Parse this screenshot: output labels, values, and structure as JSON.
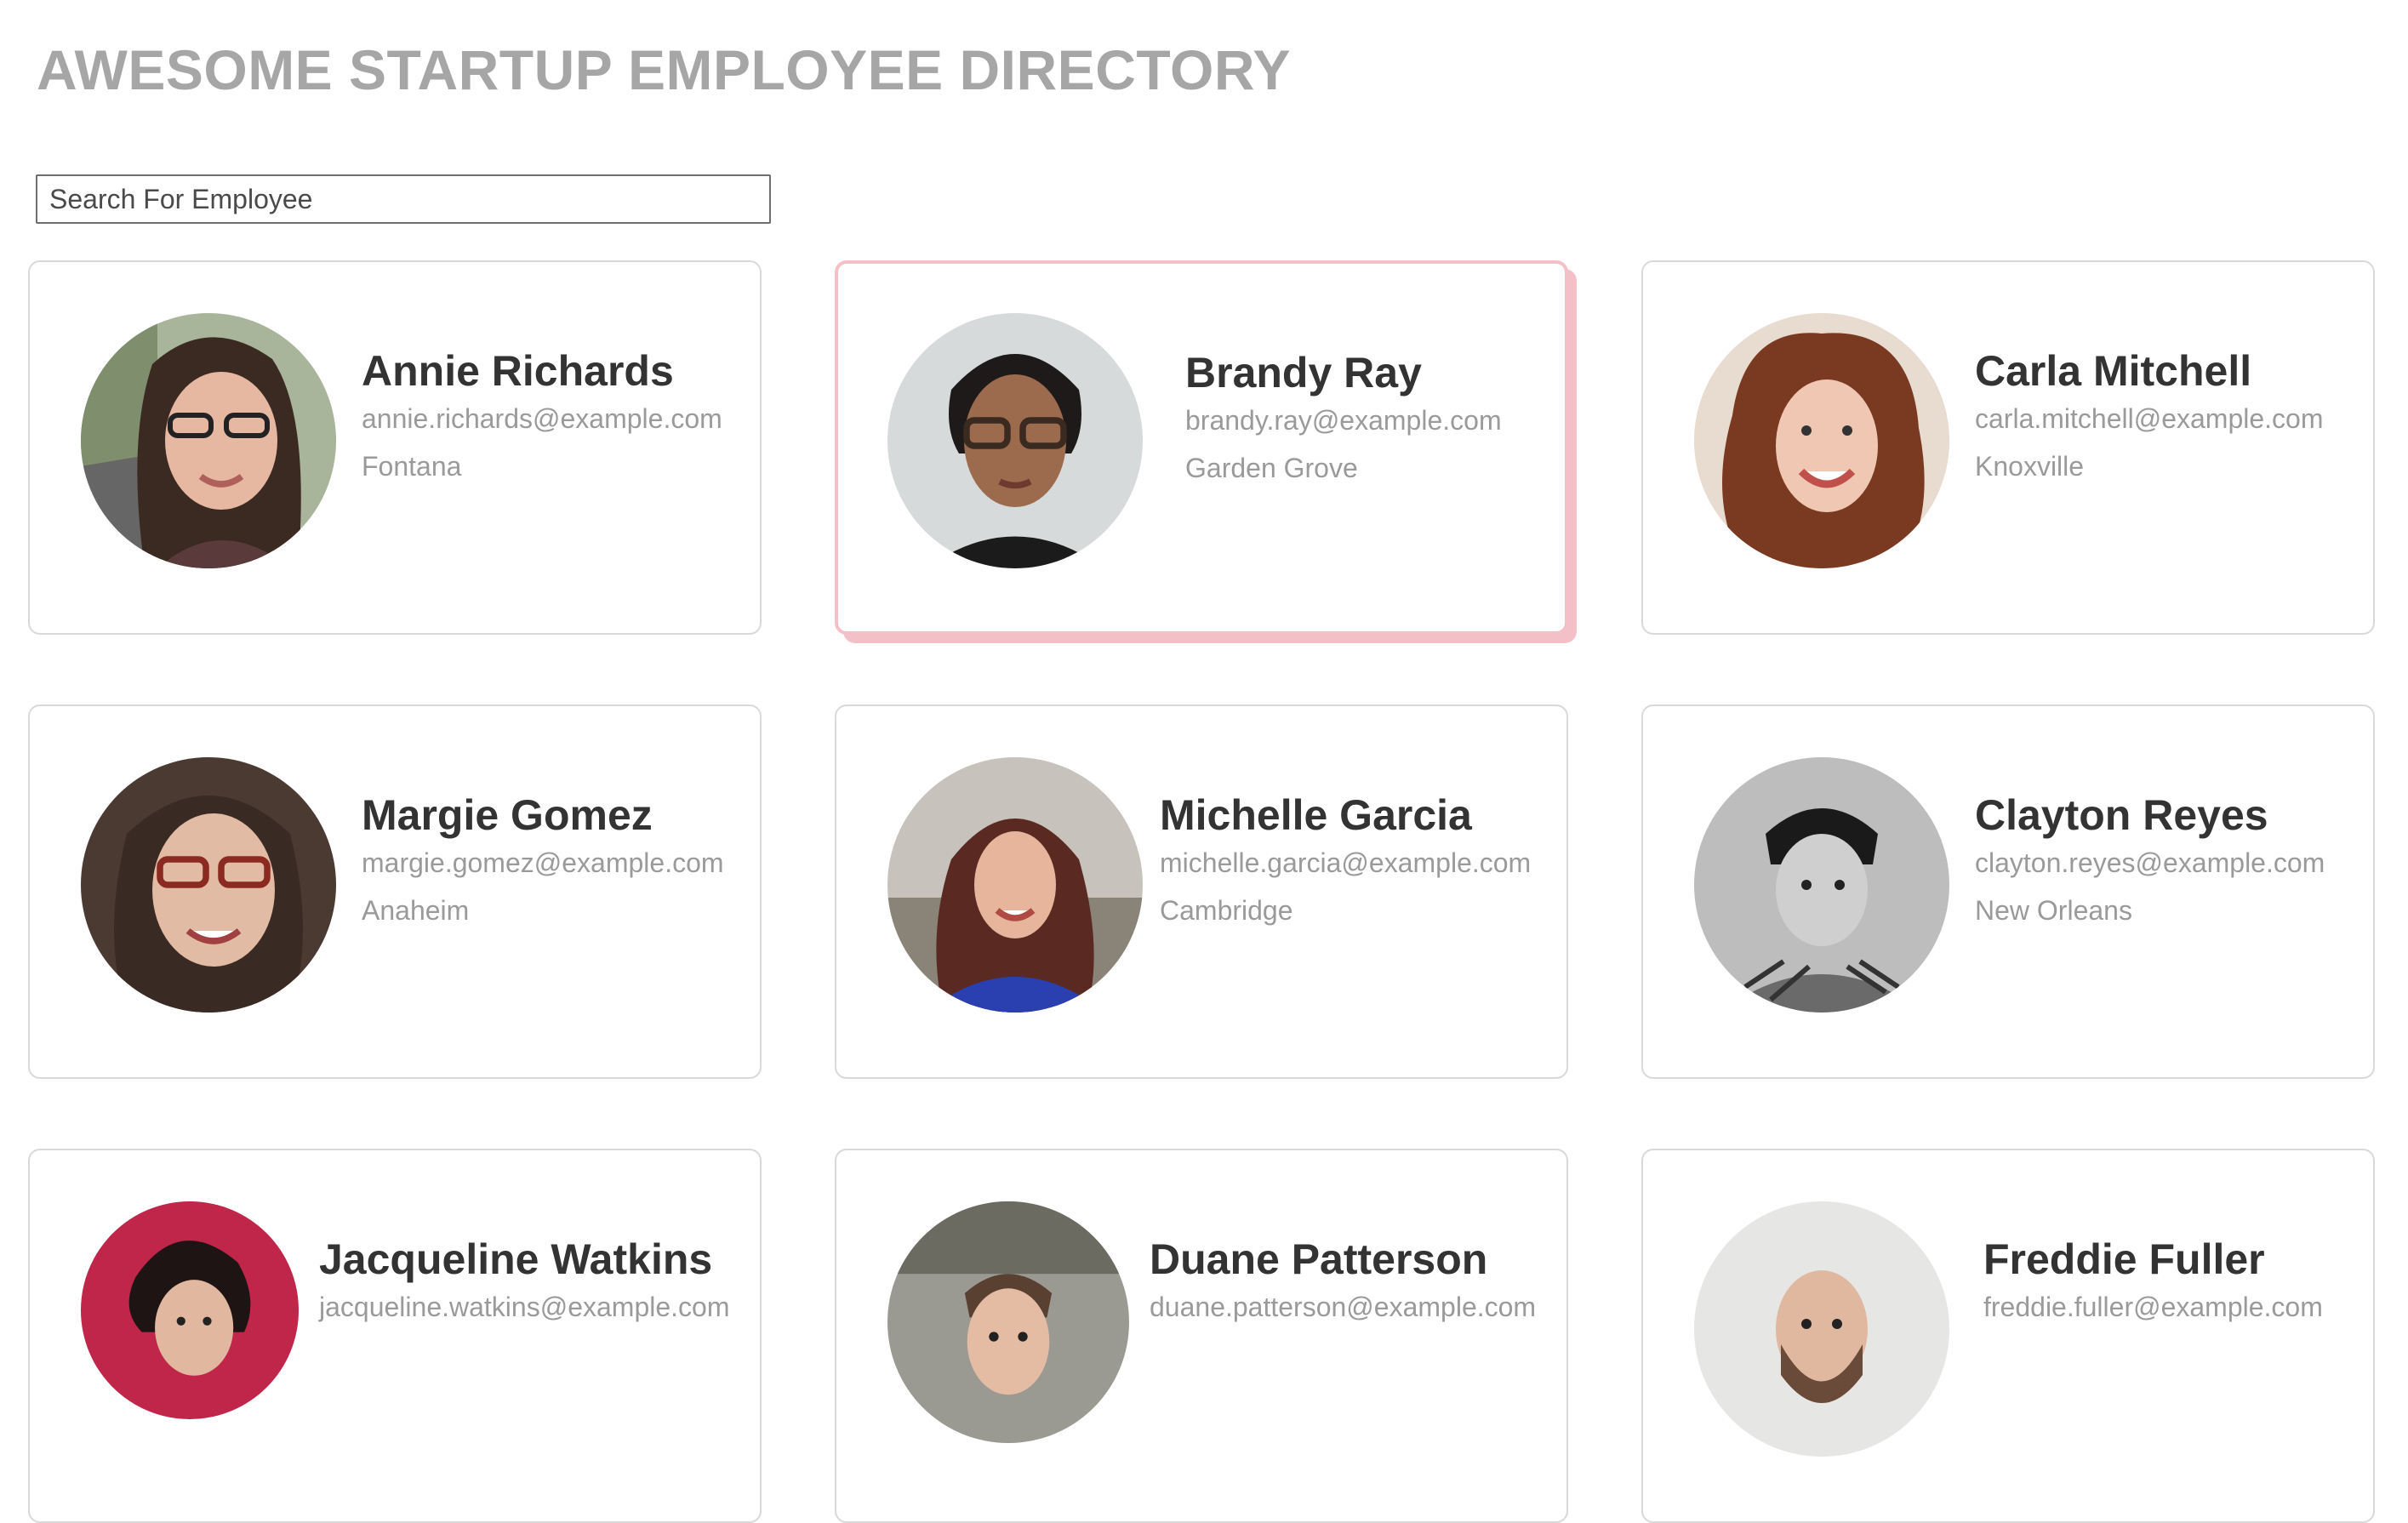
{
  "header": {
    "title": "AWESOME STARTUP EMPLOYEE DIRECTORY"
  },
  "search": {
    "placeholder": "Search For Employee",
    "value": ""
  },
  "employees": [
    {
      "name": "Annie Richards",
      "email": "annie.richards@example.com",
      "city": "Fontana"
    },
    {
      "name": "Brandy Ray",
      "email": "brandy.ray@example.com",
      "city": "Garden Grove"
    },
    {
      "name": "Carla Mitchell",
      "email": "carla.mitchell@example.com",
      "city": "Knoxville"
    },
    {
      "name": "Margie Gomez",
      "email": "margie.gomez@example.com",
      "city": "Anaheim"
    },
    {
      "name": "Michelle Garcia",
      "email": "michelle.garcia@example.com",
      "city": "Cambridge"
    },
    {
      "name": "Clayton Reyes",
      "email": "clayton.reyes@example.com",
      "city": "New Orleans"
    },
    {
      "name": "Jacqueline Watkins",
      "email": "jacqueline.watkins@example.com",
      "city": ""
    },
    {
      "name": "Duane Patterson",
      "email": "duane.patterson@example.com",
      "city": ""
    },
    {
      "name": "Freddie Fuller",
      "email": "freddie.fuller@example.com",
      "city": ""
    }
  ],
  "colors": {
    "title": "#a6a6a6",
    "card_border": "#d9d9d9",
    "highlight": "#f4c0c8",
    "name": "#333333",
    "secondary_text": "#9a9a9a"
  },
  "icons": [
    "avatar-photo"
  ]
}
